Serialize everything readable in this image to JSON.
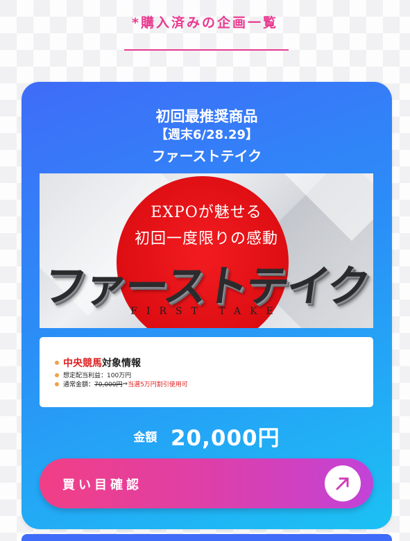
{
  "page": {
    "title": "*購入済みの企画一覧"
  },
  "card": {
    "heading": "初回最推奨商品",
    "date_label": "【週末6/28.29】",
    "product_name": "ファーストテイク",
    "banner": {
      "line1": "EXPOが魅せる",
      "line2": "初回一度限りの感動",
      "main": "ファーストテイク",
      "sub": "FIRST TAKE"
    },
    "info": {
      "row1_highlight": "中央競馬",
      "row1_rest": "対象情報",
      "row2": "想定配当利益：100万円",
      "row3_prefix": "通常金額：",
      "row3_strike": "70,000円",
      "row3_arrow": "⇒",
      "row3_highlight": "当選5万円割引使用可"
    },
    "price": {
      "label": "金額",
      "value": "20,000円"
    },
    "buy_button": {
      "label": "買い目確認",
      "icon": "arrow-up-right-icon"
    }
  },
  "colors": {
    "accent_pink": "#e8398f",
    "card_gradient_start": "#3f6cf8",
    "card_gradient_end": "#1cc1f4",
    "button_gradient_start": "#f13f86",
    "button_gradient_end": "#c243d8",
    "highlight_red": "#e02020"
  }
}
